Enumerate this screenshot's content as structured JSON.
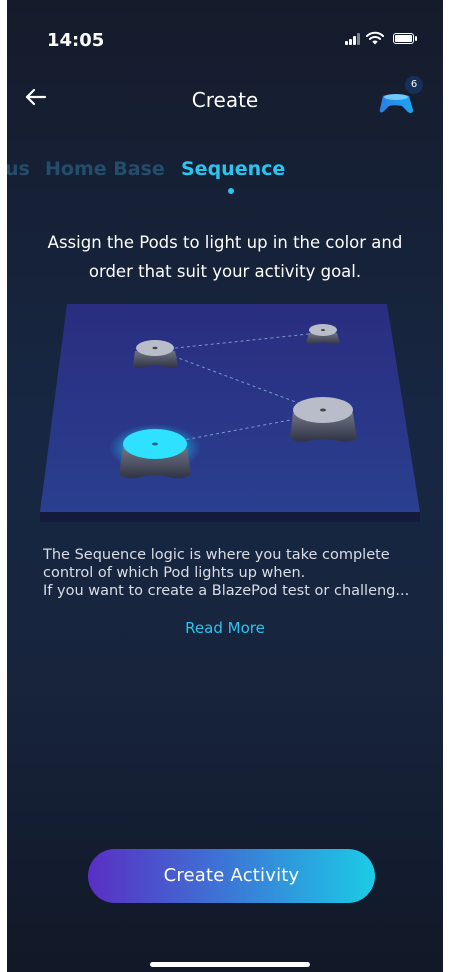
{
  "status_bar": {
    "time": "14:05"
  },
  "header": {
    "title": "Create",
    "pods_count": "6"
  },
  "tabs": [
    {
      "label": "us",
      "state": "partial"
    },
    {
      "label": "Home Base",
      "state": "inactive"
    },
    {
      "label": "Sequence",
      "state": "active"
    }
  ],
  "main": {
    "headline": "Assign the Pods to light up in the color and order that suit your activity goal.",
    "description_lines": [
      "The Sequence logic is where you take complete",
      "control of which Pod lights up when.",
      "If you want to create a BlazePod test or challeng..."
    ],
    "read_more": "Read More"
  },
  "cta": {
    "label": "Create Activity"
  },
  "colors": {
    "accent": "#2bc4ef",
    "background_top": "#151b2b",
    "background_mid": "#172743",
    "inactive_tab": "#244d6c",
    "cta_start": "#5a2fc4",
    "cta_end": "#1ccbe6"
  },
  "icons": [
    "back-arrow-icon",
    "pods-icon",
    "signal-icon",
    "wifi-icon",
    "battery-icon"
  ]
}
